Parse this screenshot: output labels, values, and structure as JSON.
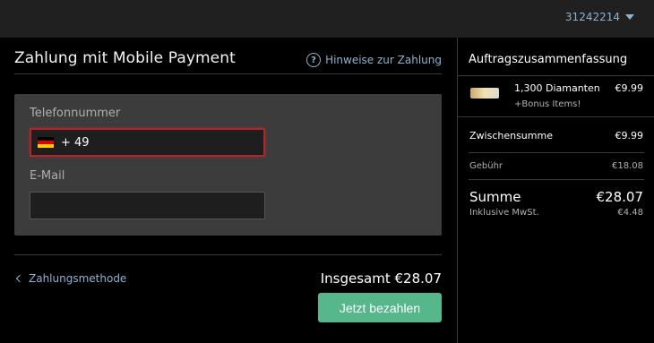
{
  "header": {
    "account_id": "31242214",
    "account_menu_icon": "caret-down-icon"
  },
  "payment": {
    "title": "Zahlung mit Mobile Payment",
    "help_link": "Hinweise zur Zahlung",
    "help_icon": "question-circle-icon",
    "phone_label": "Telefonnummer",
    "phone_country_flag": "germany-flag-icon",
    "phone_prefix": "+ 49",
    "email_label": "E-Mail",
    "email_value": "",
    "error_border_color": "#b0262a"
  },
  "footer": {
    "back_link": "Zahlungsmethode",
    "total": "Insgesamt €28.07",
    "pay_button": "Jetzt bezahlen",
    "pay_button_color": "#56b68c"
  },
  "summary": {
    "title": "Auftragszusammenfassung",
    "item": {
      "name": "1,300 Diamanten",
      "price": "€9.99",
      "bonus": "+Bonus Items!"
    },
    "subtotal_label": "Zwischensumme",
    "subtotal_value": "€9.99",
    "fee_label": "Gebühr",
    "fee_value": "€18.08",
    "sum_label": "Summe",
    "sum_value": "€28.07",
    "tax_label": "Inklusive MwSt.",
    "tax_value": "€4.48"
  },
  "colors": {
    "link": "#8fb2cf",
    "panel": "#3c3c3c"
  }
}
